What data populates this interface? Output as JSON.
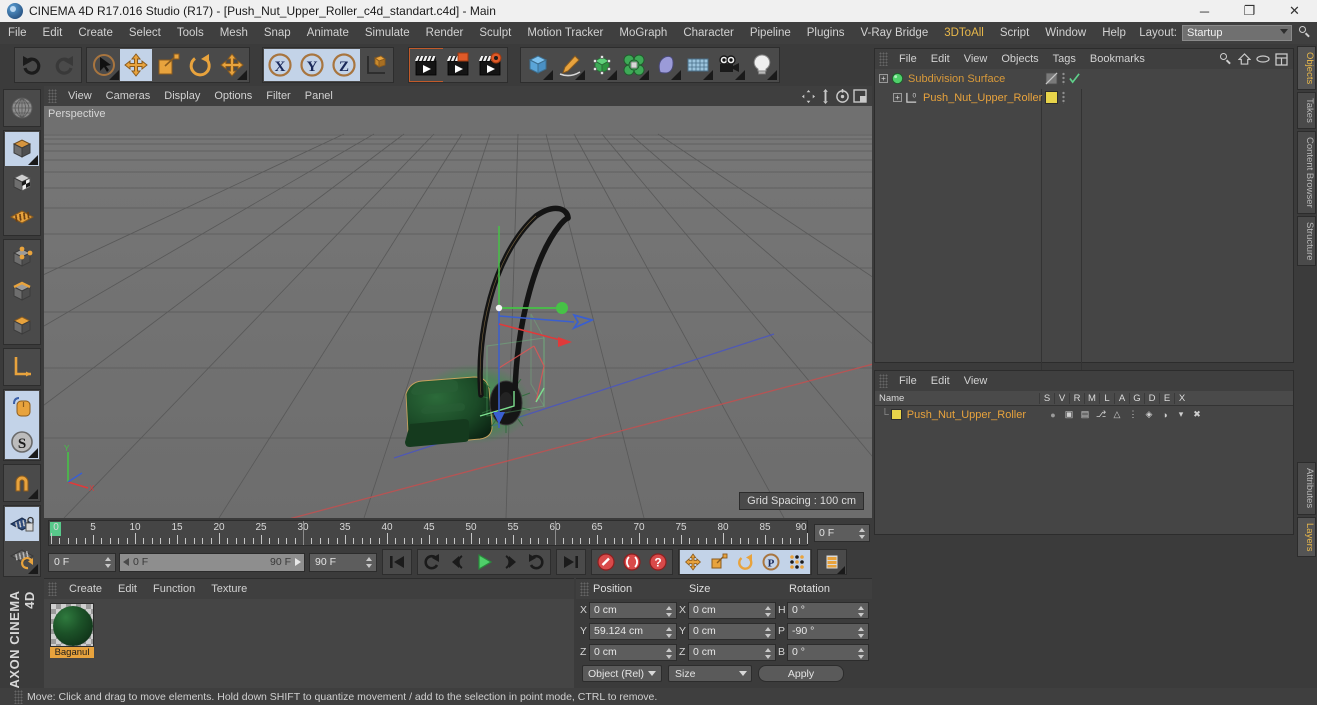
{
  "titlebar": {
    "app_icon": "c4d-logo-icon",
    "title": "CINEMA 4D R17.016 Studio (R17) - [Push_Nut_Upper_Roller_c4d_standart.c4d] - Main",
    "minimize": "─",
    "maximize": "❐",
    "close": "✕"
  },
  "menubar": {
    "items": [
      {
        "label": "File"
      },
      {
        "label": "Edit"
      },
      {
        "label": "Create"
      },
      {
        "label": "Select"
      },
      {
        "label": "Tools"
      },
      {
        "label": "Mesh"
      },
      {
        "label": "Snap"
      },
      {
        "label": "Animate"
      },
      {
        "label": "Simulate"
      },
      {
        "label": "Render"
      },
      {
        "label": "Sculpt"
      },
      {
        "label": "Motion Tracker"
      },
      {
        "label": "MoGraph"
      },
      {
        "label": "Character"
      },
      {
        "label": "Pipeline"
      },
      {
        "label": "Plugins"
      },
      {
        "label": "V-Ray Bridge"
      },
      {
        "label": "3DToAll",
        "accent": true
      },
      {
        "label": "Script"
      },
      {
        "label": "Window"
      },
      {
        "label": "Help"
      }
    ],
    "layout_label": "Layout:",
    "layout_value": "Startup",
    "search_icon": "magnifier-icon"
  },
  "toolbar": {
    "groups": [
      {
        "name": "undo-redo",
        "buttons": [
          {
            "name": "undo-button",
            "icon": "undo-arrow-icon",
            "selected": false,
            "disabled": false
          },
          {
            "name": "redo-button",
            "icon": "redo-arrow-icon",
            "selected": false,
            "disabled": true
          }
        ]
      },
      {
        "name": "transform-tools",
        "buttons": [
          {
            "name": "select-tool",
            "icon": "cursor-arrow-icon",
            "selected": false,
            "corner": true
          },
          {
            "name": "move-tool",
            "icon": "move-cross-icon",
            "selected": true
          },
          {
            "name": "scale-tool",
            "icon": "scale-square-icon",
            "selected": false
          },
          {
            "name": "rotate-tool",
            "icon": "rotate-circle-icon",
            "selected": false
          },
          {
            "name": "transform-tool",
            "icon": "move-cross-icon",
            "selected": false,
            "corner": true
          }
        ]
      },
      {
        "name": "axis-locks",
        "buttons": [
          {
            "name": "lock-x-axis",
            "icon": "x-axis-icon",
            "label": "X",
            "selected": true
          },
          {
            "name": "lock-y-axis",
            "icon": "y-axis-icon",
            "label": "Y",
            "selected": true
          },
          {
            "name": "lock-z-axis",
            "icon": "z-axis-icon",
            "label": "Z",
            "selected": true
          },
          {
            "name": "world-object-coordinates",
            "icon": "axis-cube-icon",
            "selected": false
          }
        ]
      },
      {
        "name": "render-tools",
        "buttons": [
          {
            "name": "render-view-button",
            "icon": "clapper-icon",
            "selected": false,
            "active_border": true
          },
          {
            "name": "render-region-button",
            "icon": "clapper-region-icon",
            "selected": false
          },
          {
            "name": "render-settings-button",
            "icon": "clapper-gear-icon",
            "selected": false
          }
        ]
      },
      {
        "name": "create-objects",
        "buttons": [
          {
            "name": "add-cube-button",
            "icon": "blue-cube-icon",
            "selected": false,
            "corner": true
          },
          {
            "name": "add-spline-button",
            "icon": "pen-spline-icon",
            "selected": false,
            "corner": true
          },
          {
            "name": "add-nurbs-button",
            "icon": "green-cube-nurbs-icon",
            "selected": false,
            "corner": true
          },
          {
            "name": "add-array-button",
            "icon": "cloner-array-icon",
            "selected": false,
            "corner": true
          },
          {
            "name": "add-deformer-button",
            "icon": "bend-deformer-icon",
            "selected": false,
            "corner": true
          },
          {
            "name": "add-scene-button",
            "icon": "floor-grid-icon",
            "selected": false,
            "corner": true
          },
          {
            "name": "add-camera-button",
            "icon": "camera-icon",
            "selected": false,
            "corner": true
          },
          {
            "name": "add-light-button",
            "icon": "lightbulb-icon",
            "selected": false,
            "corner": true
          }
        ]
      }
    ]
  },
  "left_toolbar": {
    "groups": [
      {
        "buttons": [
          {
            "name": "viewport-globe-tool",
            "icon": "wireframe-globe-icon",
            "selected": false
          }
        ]
      },
      {
        "buttons": [
          {
            "name": "model-mode-tool",
            "icon": "model-cube-icon",
            "selected": true,
            "corner": true
          },
          {
            "name": "texture-mode-tool",
            "icon": "checker-cube-icon",
            "selected": false
          },
          {
            "name": "uv-mesh-tool",
            "icon": "uv-grid-icon",
            "selected": false
          }
        ]
      },
      {
        "buttons": [
          {
            "name": "points-mode-tool",
            "icon": "point-cube-icon",
            "selected": false
          },
          {
            "name": "edges-mode-tool",
            "icon": "edge-cube-icon",
            "selected": false
          },
          {
            "name": "polygons-mode-tool",
            "icon": "polygon-cube-icon",
            "selected": false
          }
        ]
      },
      {
        "buttons": [
          {
            "name": "axis-modify-tool",
            "icon": "axis-L-icon",
            "selected": false
          }
        ]
      },
      {
        "buttons": [
          {
            "name": "enable-mouse-tool",
            "icon": "mouse-icon",
            "selected": true
          },
          {
            "name": "soft-selection-tool",
            "icon": "s-circle-icon",
            "selected": true,
            "corner": true
          }
        ]
      },
      {
        "buttons": [
          {
            "name": "snap-magnet-tool",
            "icon": "magnet-icon",
            "selected": false,
            "corner": true
          }
        ]
      },
      {
        "buttons": [
          {
            "name": "lock-workplane-tool",
            "icon": "grid-lock-icon",
            "selected": true
          },
          {
            "name": "workplane-rotate-tool",
            "icon": "grid-rotate-icon",
            "selected": false,
            "corner": true
          }
        ]
      }
    ],
    "brand_line1": "MAXON",
    "brand_line2": "CINEMA 4D"
  },
  "viewport": {
    "menus": [
      "View",
      "Cameras",
      "Display",
      "Options",
      "Filter",
      "Panel"
    ],
    "nav_icons": [
      "pan-icon",
      "zoom-icon",
      "orbit-icon",
      "maximize-view-icon"
    ],
    "perspective_label": "Perspective",
    "grid_spacing": "Grid Spacing : 100 cm",
    "gizmo": {
      "x_axis_color": "#e03a3a",
      "y_axis_color": "#46c246",
      "z_axis_color": "#3a5fd0"
    },
    "model": {
      "name": "push mower",
      "body_color": "#1d4a27",
      "handle_color": "#1a1a1a",
      "highlight_color": "#35a04b"
    }
  },
  "timeline": {
    "ruler_min": 0,
    "ruler_max": 90,
    "tick_step": 5,
    "labels": [
      "0",
      "5",
      "10",
      "15",
      "20",
      "25",
      "30",
      "35",
      "40",
      "45",
      "50",
      "55",
      "60",
      "65",
      "70",
      "75",
      "80",
      "85",
      "90"
    ],
    "current_frame_field": "0 F",
    "start_field": "0 F",
    "range_start": "0 F",
    "range_end": "90 F",
    "end_field": "90 F",
    "transport": [
      {
        "name": "go-to-start-button",
        "icon": "skip-start-icon"
      },
      {
        "name": "play-backwards-loop-button",
        "icon": "loop-back-icon"
      },
      {
        "name": "step-back-button",
        "icon": "step-back-icon"
      },
      {
        "name": "play-button",
        "icon": "play-icon",
        "accent": "#4fd06a"
      },
      {
        "name": "step-forward-button",
        "icon": "step-forward-icon"
      },
      {
        "name": "play-forwards-loop-button",
        "icon": "loop-forward-icon"
      },
      {
        "name": "go-to-end-button",
        "icon": "skip-end-icon"
      }
    ],
    "record_tools": [
      {
        "name": "record-keyframe-button",
        "icon": "record-key-icon"
      },
      {
        "name": "autokeying-button",
        "icon": "autokey-icon"
      },
      {
        "name": "keyframe-selection-button",
        "icon": "key-question-icon"
      }
    ],
    "key_tools": [
      {
        "name": "record-position-button",
        "icon": "position-cross-icon",
        "selected": true
      },
      {
        "name": "record-scale-button",
        "icon": "scale-key-icon",
        "selected": true
      },
      {
        "name": "record-rotation-button",
        "icon": "rotation-key-icon",
        "selected": true
      },
      {
        "name": "record-pla-button",
        "icon": "pla-key-icon",
        "selected": true
      },
      {
        "name": "keyframe-dots-button",
        "icon": "dot-matrix-icon",
        "selected": true
      }
    ],
    "extra_tool": {
      "name": "timeline-view-button",
      "icon": "layers-stack-icon"
    }
  },
  "material_manager": {
    "menus": [
      "Create",
      "Edit",
      "Function",
      "Texture"
    ],
    "materials": [
      {
        "name": "Baganul",
        "preview": "green-sphere-preview",
        "color": "#1c5228"
      }
    ]
  },
  "coordinates": {
    "headers": [
      "Position",
      "Size",
      "Rotation"
    ],
    "rows": [
      {
        "labels": [
          "X",
          "X",
          "H"
        ],
        "values": [
          "0 cm",
          "0 cm",
          "0 °"
        ]
      },
      {
        "labels": [
          "Y",
          "Y",
          "P"
        ],
        "values": [
          "59.124 cm",
          "0 cm",
          "-90 °"
        ]
      },
      {
        "labels": [
          "Z",
          "Z",
          "B"
        ],
        "values": [
          "0 cm",
          "0 cm",
          "0 °"
        ]
      }
    ],
    "mode_dropdown": "Object (Rel)",
    "size_dropdown": "Size",
    "apply_button": "Apply"
  },
  "object_manager": {
    "menus": [
      "File",
      "Edit",
      "View",
      "Objects",
      "Tags",
      "Bookmarks"
    ],
    "header_icons": [
      "search-icon",
      "home-icon",
      "link-icon",
      "layout-icon"
    ],
    "rows": [
      {
        "name": "Subdivision Surface",
        "indent": 0,
        "icon": "subdivision-surface-icon",
        "icon_color": "#4fd06a",
        "name_color": "#d99a3a",
        "tag": "hidden-tag",
        "check": true
      },
      {
        "name": "Push_Nut_Upper_Roller",
        "indent": 1,
        "icon": "polygon-object-icon",
        "icon_color": "#d8d8d8",
        "name_color": "#e8a33d",
        "tag": "material-tag",
        "tag_color": "#e8d44a",
        "check": false
      }
    ]
  },
  "layer_manager": {
    "menus": [
      "File",
      "Edit",
      "View"
    ],
    "columns": [
      "Name",
      "S",
      "V",
      "R",
      "M",
      "L",
      "A",
      "G",
      "D",
      "E",
      "X"
    ],
    "rows": [
      {
        "name": "Push_Nut_Upper_Roller",
        "color": "#e8d44a",
        "name_color": "#e8a33d",
        "cells": [
          "dot",
          "view-icon",
          "render-icon",
          "manager-icon",
          "lock-icon",
          "anim-icon",
          "generator-icon",
          "deform-icon",
          "expression-icon",
          "xref-icon"
        ]
      }
    ]
  },
  "right_tabs": [
    {
      "label": "Objects",
      "active": true
    },
    {
      "label": "Takes",
      "active": false
    },
    {
      "label": "Content Browser",
      "active": false
    },
    {
      "label": "Structure",
      "active": false
    },
    {
      "label": "Attributes",
      "active": false
    },
    {
      "label": "Layers",
      "active": true
    }
  ],
  "status_bar": {
    "text": "Move: Click and drag to move elements. Hold down SHIFT to quantize movement / add to the selection in point mode, CTRL to remove."
  }
}
